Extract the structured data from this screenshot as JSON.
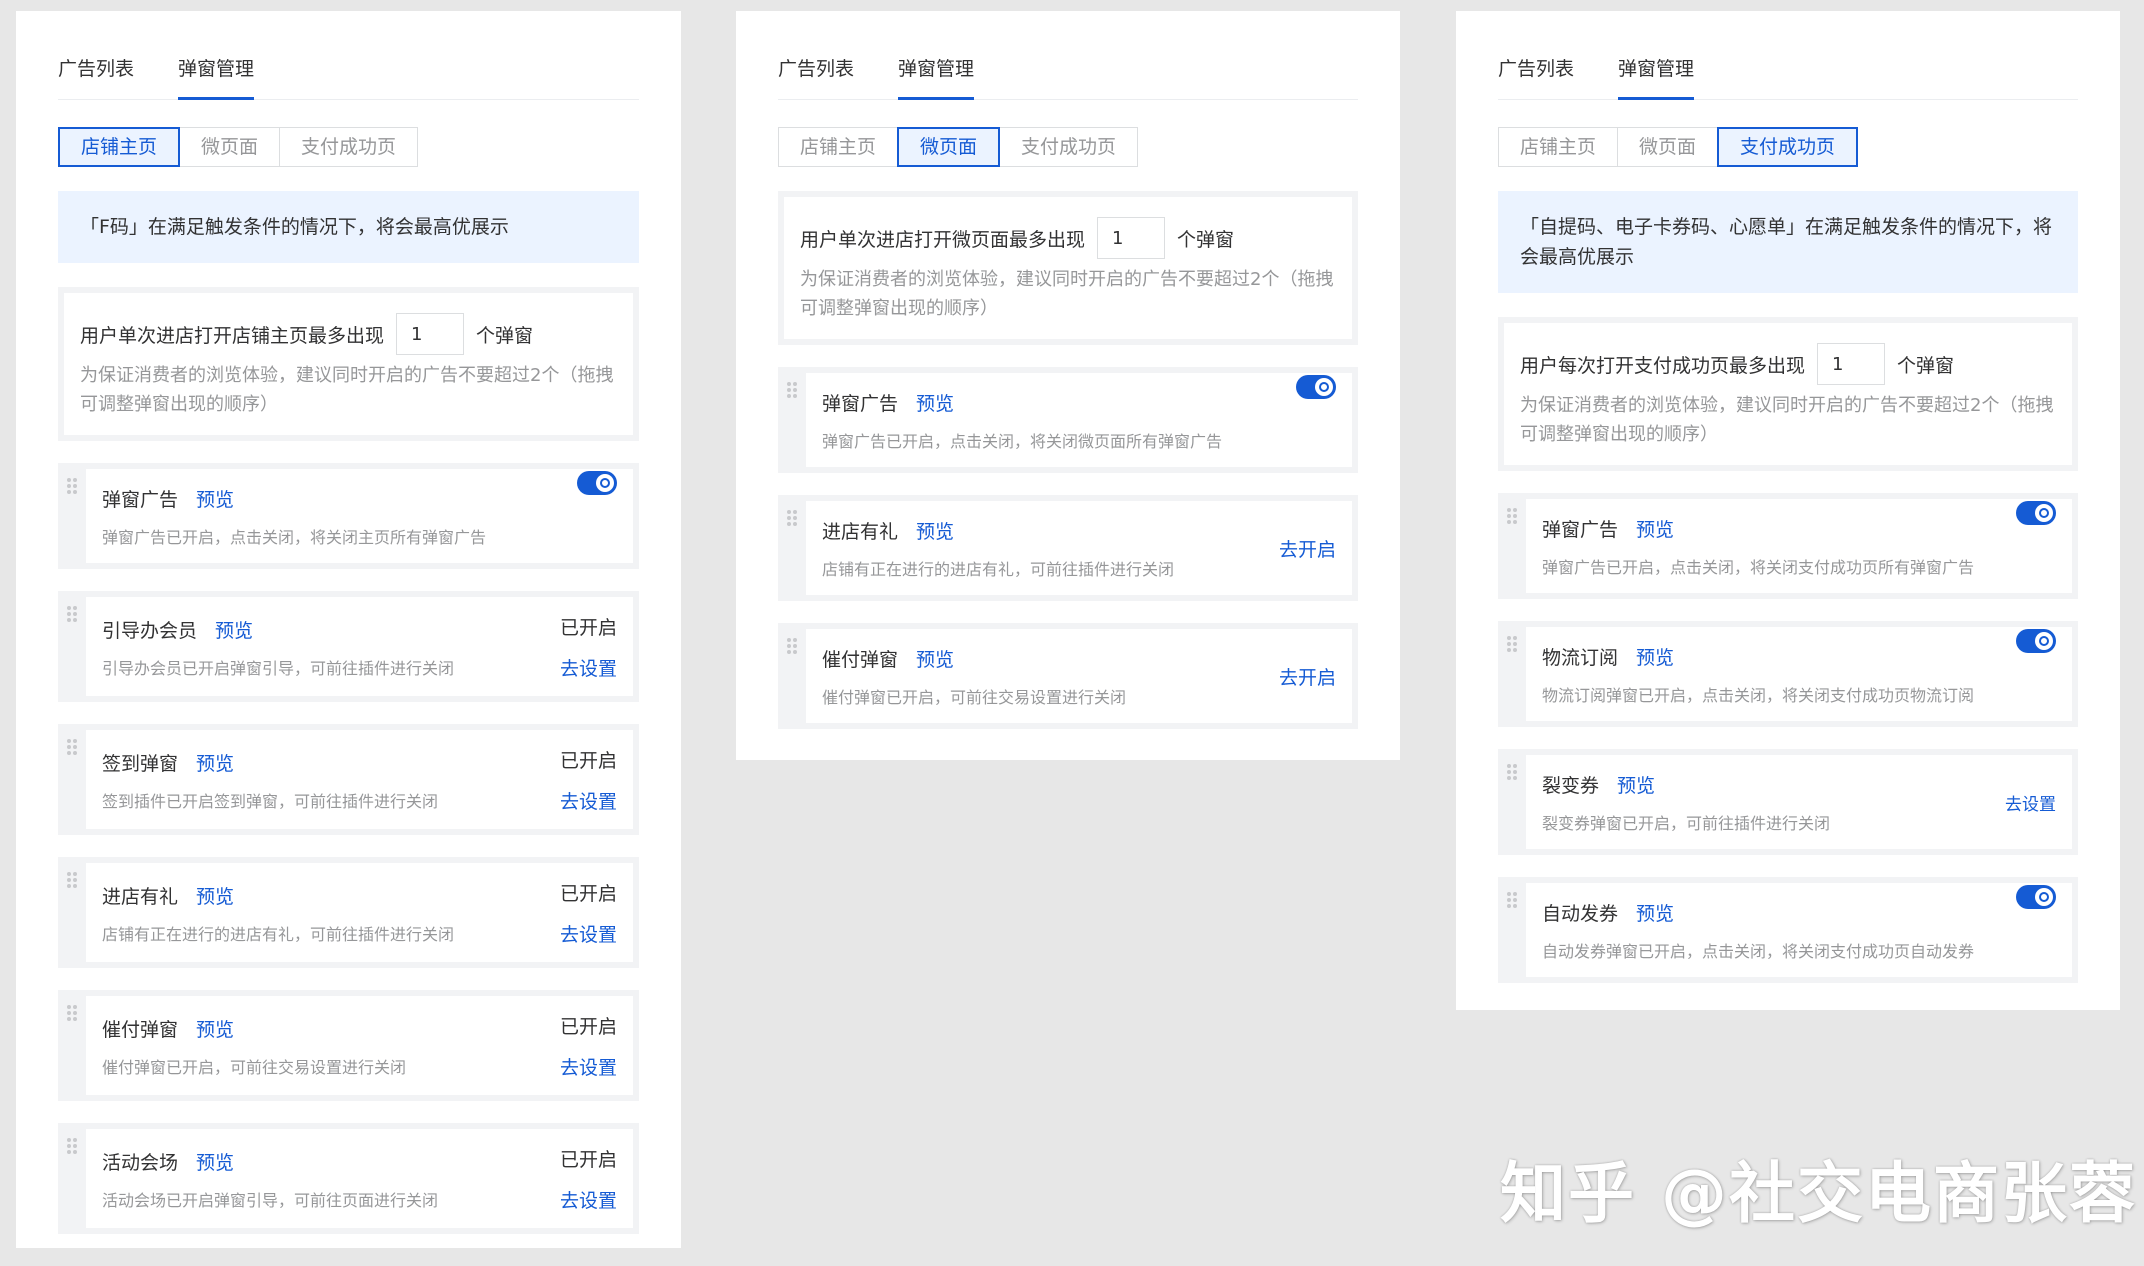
{
  "tabs": [
    "广告列表",
    "弹窗管理"
  ],
  "segments": [
    "店铺主页",
    "微页面",
    "支付成功页"
  ],
  "common": {
    "preview": "预览",
    "unit": "个弹窗",
    "hint": "为保证消费者的浏览体验，建议同时开启的广告不要超过2个（拖拽可调整弹窗出现的顺序）",
    "status_on": "已开启",
    "go_setting": "去设置",
    "go_enable": "去开启"
  },
  "frame1": {
    "notice": "「F码」在满足触发条件的情况下，将会最高优展示",
    "limit_label": "用户单次进店打开店铺主页最多出现",
    "limit_value": "1",
    "items": [
      {
        "title": "弹窗广告",
        "desc": "弹窗广告已开启，点击关闭，将关闭主页所有弹窗广告"
      },
      {
        "title": "引导办会员",
        "desc": "引导办会员已开启弹窗引导，可前往插件进行关闭"
      },
      {
        "title": "签到弹窗",
        "desc": "签到插件已开启签到弹窗，可前往插件进行关闭"
      },
      {
        "title": "进店有礼",
        "desc": "店铺有正在进行的进店有礼，可前往插件进行关闭"
      },
      {
        "title": "催付弹窗",
        "desc": "催付弹窗已开启，可前往交易设置进行关闭"
      },
      {
        "title": "活动会场",
        "desc": "活动会场已开启弹窗引导，可前往页面进行关闭"
      }
    ]
  },
  "frame2": {
    "limit_label": "用户单次进店打开微页面最多出现",
    "limit_value": "1",
    "items": [
      {
        "title": "弹窗广告",
        "desc": "弹窗广告已开启，点击关闭，将关闭微页面所有弹窗广告"
      },
      {
        "title": "进店有礼",
        "desc": "店铺有正在进行的进店有礼，可前往插件进行关闭"
      },
      {
        "title": "催付弹窗",
        "desc": "催付弹窗已开启，可前往交易设置进行关闭"
      }
    ]
  },
  "frame3": {
    "notice": "「自提码、电子卡券码、心愿单」在满足触发条件的情况下，将会最高优展示",
    "limit_label": "用户每次打开支付成功页最多出现",
    "limit_value": "1",
    "items": [
      {
        "title": "弹窗广告",
        "desc": "弹窗广告已开启，点击关闭，将关闭支付成功页所有弹窗广告"
      },
      {
        "title": "物流订阅",
        "desc": "物流订阅弹窗已开启，点击关闭，将关闭支付成功页物流订阅"
      },
      {
        "title": "裂变券",
        "desc": "裂变券弹窗已开启，可前往插件进行关闭"
      },
      {
        "title": "自动发券",
        "desc": "自动发券弹窗已开启，点击关闭，将关闭支付成功页自动发券"
      }
    ]
  },
  "watermark": "知乎 @社交电商张蓉",
  "colors": {
    "accent": "#155bd4",
    "muted": "#969799",
    "bg": "#e7e7e7"
  }
}
